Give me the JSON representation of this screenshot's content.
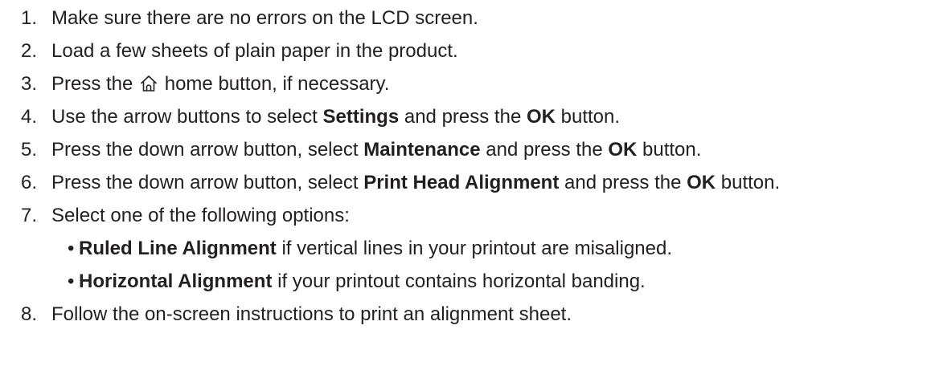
{
  "steps": [
    {
      "number": "1.",
      "text": "Make sure there are no errors on the LCD screen."
    },
    {
      "number": "2.",
      "text": "Load a few sheets of plain paper in the product."
    },
    {
      "number": "3.",
      "before": "Press the",
      "icon": "home-icon",
      "after": "home button, if necessary."
    },
    {
      "number": "4.",
      "parts": [
        "Use the arrow buttons to select ",
        "Settings",
        " and press the ",
        "OK",
        " button."
      ]
    },
    {
      "number": "5.",
      "parts": [
        "Press the down arrow button, select ",
        "Maintenance",
        " and press the ",
        "OK",
        " button."
      ]
    },
    {
      "number": "6.",
      "parts": [
        "Press the down arrow button, select ",
        "Print Head Alignment",
        " and press the ",
        "OK",
        " button."
      ]
    },
    {
      "number": "7.",
      "text": "Select one of the following options:"
    },
    {
      "number": "8.",
      "text": "Follow the on-screen instructions to print an alignment sheet."
    }
  ],
  "options": [
    {
      "bullet": "•",
      "bold": "Ruled Line Alignment",
      "rest": " if vertical lines in your printout are misaligned."
    },
    {
      "bullet": "•",
      "bold": "Horizontal Alignment",
      "rest": " if your printout contains horizontal banding."
    }
  ]
}
